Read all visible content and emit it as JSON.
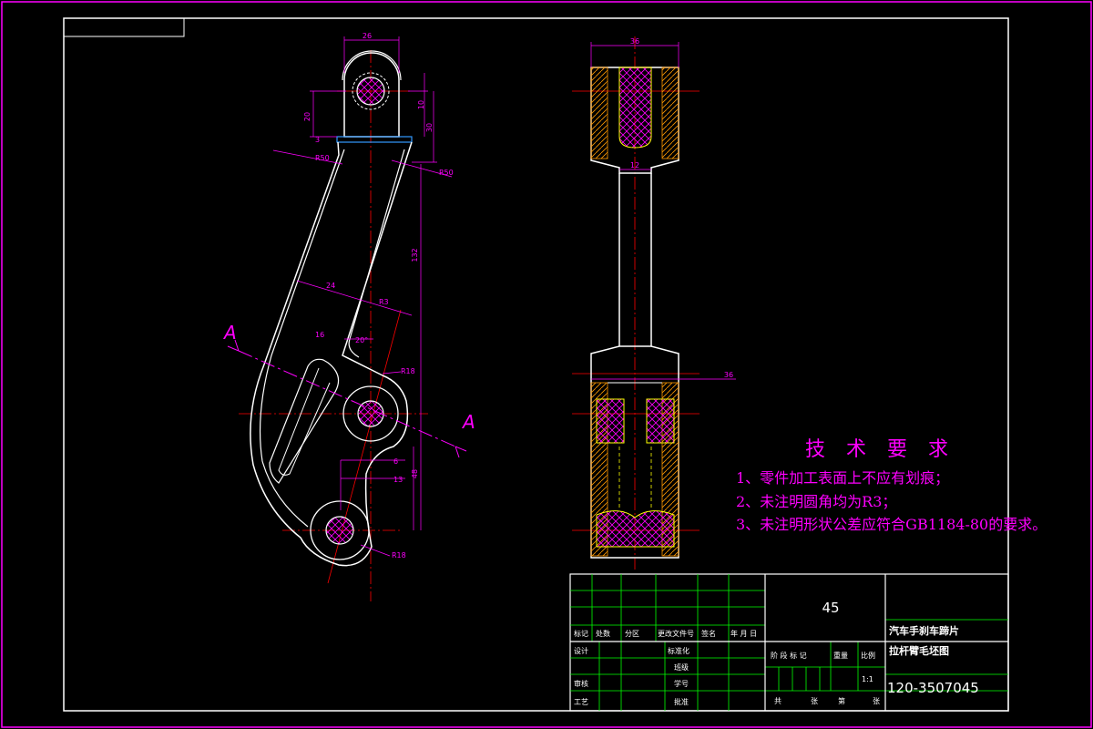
{
  "colors": {
    "outline": "#ffffff",
    "frame": "#ff00ff",
    "centerline": "#ff0000",
    "dimension": "#ff00ff",
    "hatch": "#ff00ff",
    "hidden": "#ffff00",
    "hatch_fill": "#ff9900",
    "machined_face": "#3399ff",
    "title_grid": "#00ff00",
    "title_text": "#ffffff"
  },
  "section_marker": {
    "label_left": "A",
    "label_right": "A"
  },
  "front_view_dims": {
    "top_width": "26",
    "left_height": "20",
    "right_height_a": "10",
    "right_height_b": "30",
    "roughness": "3",
    "radius_upper_left": "R50",
    "radius_upper_right": "R50",
    "arm_length": "132",
    "arm_width": "24",
    "diag_dim": "R3",
    "inner_width": "16",
    "angle": "20°",
    "radius_mid": "R18",
    "small_dim": "6",
    "offset_dim": "13",
    "lower_height": "48",
    "radius_bottom": "R18"
  },
  "side_view_dims": {
    "top_width": "36",
    "neck_width": "12",
    "lower_width": "36"
  },
  "tech_requirements": {
    "title": "技 术 要 求",
    "items": [
      "1、零件加工表面上不应有划痕；",
      "2、未注明圆角均为R3；",
      "3、未注明形状公差应符合GB1184-80的要求。"
    ]
  },
  "title_block": {
    "material": "45",
    "part_name_line1": "汽车手刹车蹄片",
    "part_name_line2": "拉杆臂毛坯图",
    "drawing_number": "120-3507045",
    "scale": "1:1",
    "revision_headers": [
      "标记",
      "处数",
      "分区",
      "更改文件号",
      "签名",
      "年 月 日"
    ],
    "row_design": "设计",
    "row_standardize": "标准化",
    "row_check_class": "班级",
    "row_review": "审核",
    "row_student_no": "学号",
    "row_process": "工艺",
    "row_approve": "批准",
    "stage_headers": [
      "阶 段 标 记",
      "重量",
      "比例"
    ],
    "sheets": [
      "共",
      "张",
      "第",
      "张"
    ]
  }
}
